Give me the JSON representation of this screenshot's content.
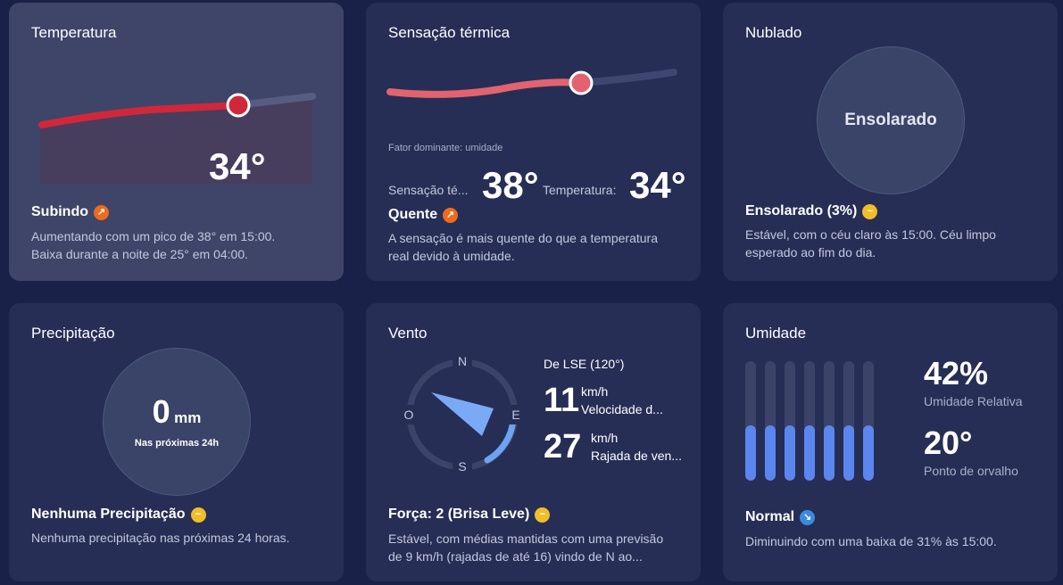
{
  "temperature": {
    "title": "Temperatura",
    "value": "34°",
    "status": "Subindo",
    "status_icon": "trend-up-icon",
    "desc_line1": "Aumentando com um pico de 38° em 15:00.",
    "desc_line2": "Baixa durante a noite de 25° em 04:00."
  },
  "feels_like": {
    "title": "Sensação térmica",
    "dominant": "Fator dominante: umidade",
    "feels_label": "Sensação té...",
    "feels_value": "38°",
    "temp_label": "Temperatura:",
    "temp_value": "34°",
    "status": "Quente",
    "status_icon": "trend-up-icon",
    "desc_line1": "A sensação é mais quente do que a temperatura",
    "desc_line2": "real devido à umidade."
  },
  "cloud": {
    "title": "Nublado",
    "circle_label": "Ensolarado",
    "status": "Ensolarado (3%)",
    "status_icon": "steady-icon",
    "desc_line1": "Estável, com o céu claro às 15:00. Céu limpo",
    "desc_line2": "esperado ao fim do dia."
  },
  "precip": {
    "title": "Precipitação",
    "value": "0",
    "unit": "mm",
    "sub": "Nas próximas 24h",
    "status": "Nenhuma Precipitação",
    "status_icon": "steady-icon",
    "desc": "Nenhuma precipitação nas próximas 24 horas."
  },
  "wind": {
    "title": "Vento",
    "compass": {
      "n": "N",
      "e": "E",
      "s": "S",
      "w": "O"
    },
    "direction_deg": 120,
    "direction": "De LSE (120°)",
    "speed": "11",
    "speed_unit": "km/h",
    "speed_label": "Velocidade d...",
    "gust": "27",
    "gust_unit": "km/h",
    "gust_label": "Rajada de ven...",
    "status": "Força: 2 (Brisa Leve)",
    "status_icon": "steady-icon",
    "desc_line1": "Estável, com médias mantidas com uma previsão",
    "desc_line2": "de 9 km/h (rajadas de até 16) vindo de N ao..."
  },
  "humidity": {
    "title": "Umidade",
    "value": "42%",
    "value_label": "Umidade Relativa",
    "dew": "20°",
    "dew_label": "Ponto de orvalho",
    "bar_levels": [
      0.46,
      0.46,
      0.46,
      0.46,
      0.46,
      0.46,
      0.46
    ],
    "status": "Normal",
    "status_icon": "trend-down-icon",
    "desc": "Diminuindo com uma baixa de 31% às 15:00."
  },
  "colors": {
    "background": "#1a2148",
    "card": "#262e55",
    "card_highlight": "#3e4569",
    "temp_red": "#d0283a",
    "feels_pink": "#e2636f",
    "humidity_blue": "#5b86f0"
  }
}
